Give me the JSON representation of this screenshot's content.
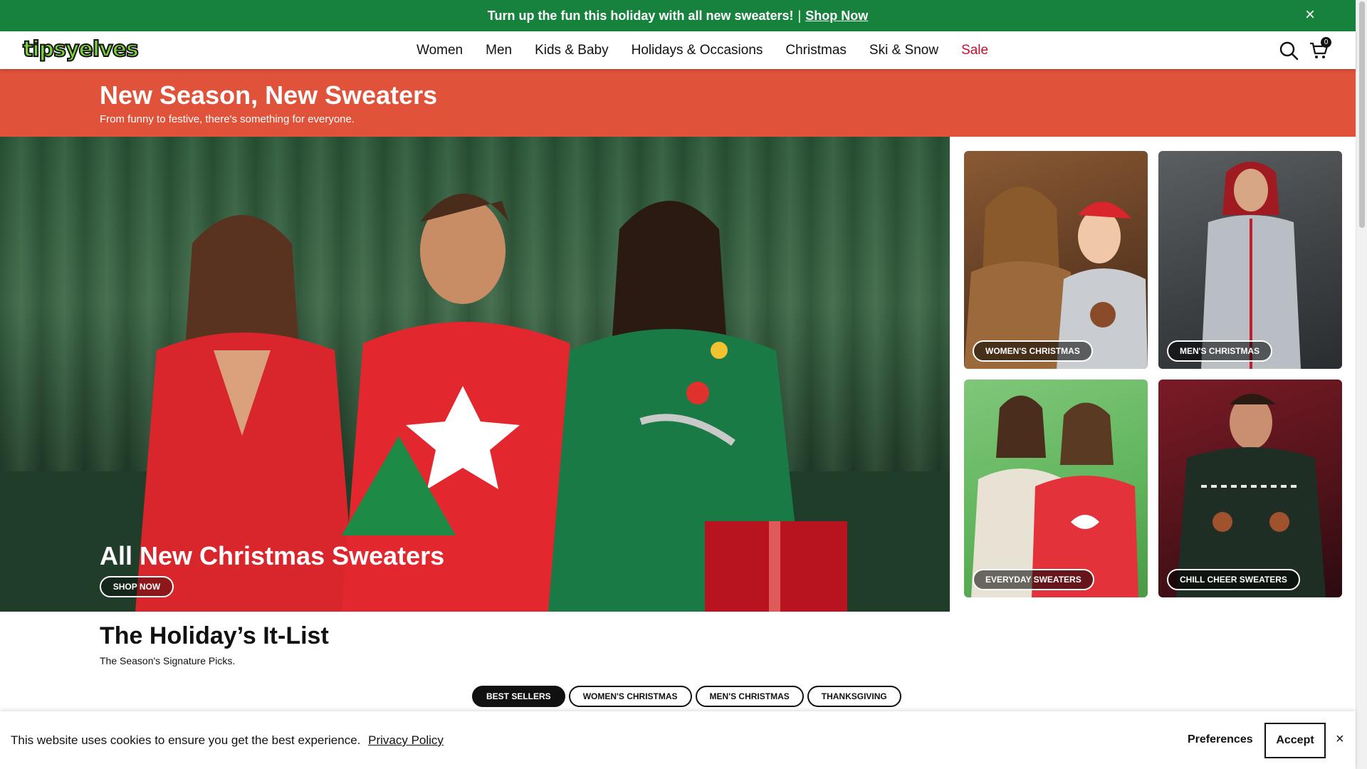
{
  "promo": {
    "message": "Turn up the fun this holiday with all new sweaters!",
    "separator": "|",
    "link": "Shop Now",
    "close": "×"
  },
  "header": {
    "logo": "tipsyelves",
    "nav": [
      "Women",
      "Men",
      "Kids & Baby",
      "Holidays & Occasions",
      "Christmas",
      "Ski & Snow",
      "Sale"
    ],
    "cart_count": "0",
    "icons": [
      "search-icon",
      "cart-icon"
    ]
  },
  "banner": {
    "title": "New Season, New Sweaters",
    "subtitle": "From funny to festive, there's something for everyone."
  },
  "hero": {
    "title": "All New Christmas Sweaters",
    "cta": "SHOP NOW"
  },
  "categories": [
    {
      "label": "WOMEN'S CHRISTMAS"
    },
    {
      "label": "MEN'S CHRISTMAS"
    },
    {
      "label": "EVERYDAY SWEATERS"
    },
    {
      "label": "CHILL CHEER SWEATERS"
    }
  ],
  "itlist": {
    "title": "The Holiday’s It-List",
    "subtitle": "The Season's Signature Picks.",
    "tabs": [
      "BEST SELLERS",
      "WOMEN'S CHRISTMAS",
      "MEN'S CHRISTMAS",
      "THANKSGIVING"
    ],
    "active_tab": "BEST SELLERS"
  },
  "cookie": {
    "message": "This website uses cookies to ensure you get the best experience.",
    "policy_link": "Privacy Policy",
    "preferences": "Preferences",
    "accept": "Accept",
    "close": "×"
  },
  "colors": {
    "promo_bg": "#17823e",
    "banner_bg": "#e0523a",
    "sale": "#c8102e"
  }
}
